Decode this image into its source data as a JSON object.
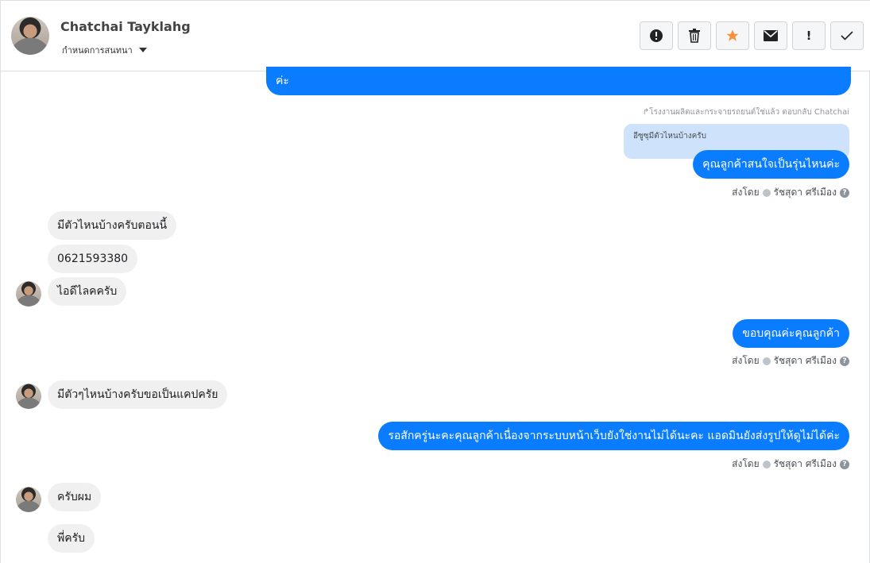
{
  "header": {
    "contact_name": "Chatchai Tayklahg",
    "subtitle": "กำหนดการสนทนา",
    "actions": [
      {
        "name": "report-icon",
        "glyph": "!"
      },
      {
        "name": "trash-icon",
        "glyph": "🗑"
      },
      {
        "name": "star-icon",
        "glyph": "★"
      },
      {
        "name": "envelope-icon",
        "glyph": "✉"
      },
      {
        "name": "exclamation-icon",
        "glyph": "!"
      },
      {
        "name": "check-icon",
        "glyph": "✓"
      }
    ]
  },
  "colors": {
    "accent": "#0a7cff",
    "star": "#f7923a",
    "incoming": "#f1f0f0",
    "quote": "#cfe2fb"
  },
  "messages": {
    "m0": "ค่ะ",
    "reply_note": "↱โรงงานผลิตและกระจายรถยนต์ใช่แล้ว ตอบกลับ Chatchai",
    "quoted": "อีซูซุมีตัวไหนบ้างครับ",
    "m1": "คุณลูกค้าสนใจเป็นรุ่นไหนค่ะ",
    "in1": "มีตัวไหนบ้างครับตอนนี้",
    "in2": "0621593380",
    "in3": "ไอดีไลคครับ",
    "m2": "ขอบคุณค่ะคุณลูกค้า",
    "in4": "มีตัวๆไหนบ้างครับขอเป็นแคปครัย",
    "m3": "รอสักครู่นะคะคุณลูกค้าเนื่องจากระบบหน้าเว็บยังใช่งานไม่ได้นะคะ แอดมินยังส่งรูปให้ดูไม่ได้ค่ะ",
    "in5": "ครับผม",
    "in6": "พี่ครับ"
  },
  "meta": {
    "sent_by": "ส่งโดย",
    "agent": "รัชสุดา ศรีเมือง",
    "help": "?"
  }
}
